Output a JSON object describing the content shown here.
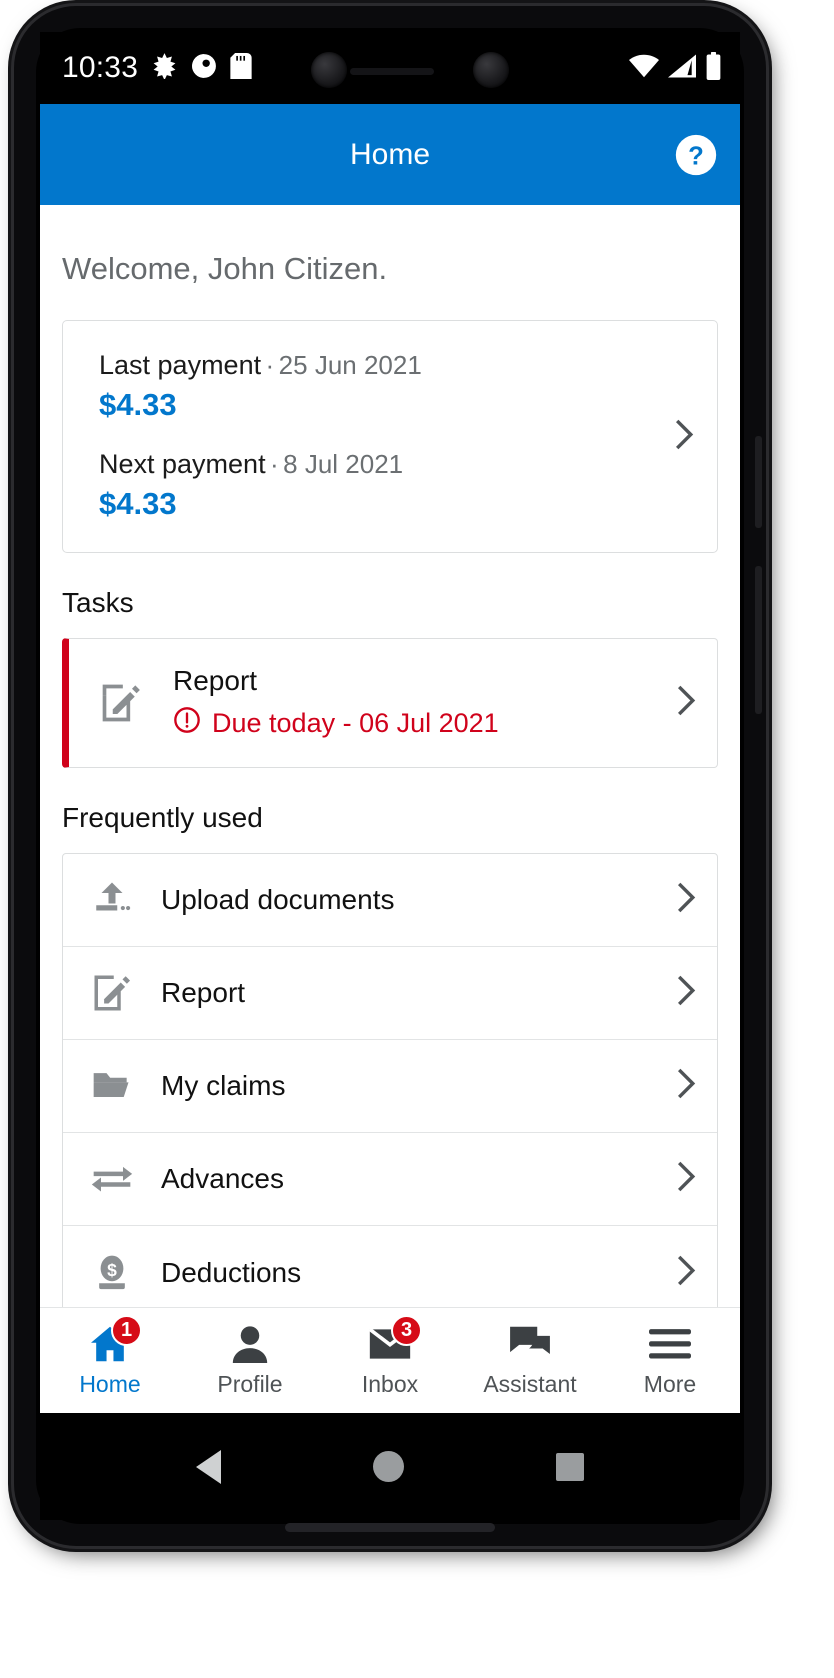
{
  "status_bar": {
    "time": "10:33",
    "left_icons": [
      "bluetooth-snowflake-icon",
      "do-not-disturb-icon",
      "sd-card-icon"
    ],
    "right_icons": [
      "wifi-icon",
      "cellular-signal-icon",
      "battery-icon"
    ]
  },
  "header": {
    "title": "Home",
    "help_icon": "help-circle-icon"
  },
  "content": {
    "welcome": "Welcome, John Citizen.",
    "payment_card": {
      "last_label": "Last payment",
      "last_separator": "·",
      "last_date": "25 Jun 2021",
      "last_amount": "$4.33",
      "next_label": "Next payment",
      "next_separator": "·",
      "next_date": "8 Jul 2021",
      "next_amount": "$4.33",
      "chevron_icon": "chevron-right-icon"
    },
    "tasks": {
      "heading": "Tasks",
      "item": {
        "icon": "edit-document-icon",
        "title": "Report",
        "alert_icon": "exclamation-circle-icon",
        "due_text": "Due today - 06 Jul 2021",
        "chevron_icon": "chevron-right-icon",
        "accent_color": "#d0021b"
      }
    },
    "frequently_used": {
      "heading": "Frequently used",
      "items": [
        {
          "label": "Upload documents",
          "icon": "upload-icon",
          "chevron_icon": "chevron-right-icon"
        },
        {
          "label": "Report",
          "icon": "edit-document-icon",
          "chevron_icon": "chevron-right-icon"
        },
        {
          "label": "My claims",
          "icon": "folder-open-icon",
          "chevron_icon": "chevron-right-icon"
        },
        {
          "label": "Advances",
          "icon": "transfer-arrows-icon",
          "chevron_icon": "chevron-right-icon"
        },
        {
          "label": "Deductions",
          "icon": "coin-dollar-icon",
          "chevron_icon": "chevron-right-icon"
        }
      ]
    }
  },
  "bottom_nav": {
    "items": [
      {
        "label": "Home",
        "icon": "home-icon",
        "badge": "1",
        "active": true
      },
      {
        "label": "Profile",
        "icon": "person-icon",
        "badge": "",
        "active": false
      },
      {
        "label": "Inbox",
        "icon": "envelope-icon",
        "badge": "3",
        "active": false
      },
      {
        "label": "Assistant",
        "icon": "chat-bubbles-icon",
        "badge": "",
        "active": false
      },
      {
        "label": "More",
        "icon": "hamburger-menu-icon",
        "badge": "",
        "active": false
      }
    ]
  },
  "system_nav": {
    "back": "back-triangle-icon",
    "home": "home-circle-icon",
    "recents": "recents-square-icon"
  },
  "colors": {
    "brand_blue": "#0277cc",
    "alert_red": "#d0021b",
    "badge_red": "#d60b17",
    "icon_grey": "#8b8f92"
  }
}
